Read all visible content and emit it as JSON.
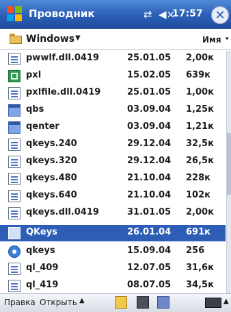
{
  "titlebar": {
    "title": "Проводник",
    "conn_icon": "⇄",
    "volume_icon": "◀×",
    "time": "17:57",
    "close_glyph": "✕"
  },
  "folderbar": {
    "folder_name": "Windows",
    "chevron": "▼",
    "sort_label": "Имя",
    "sort_chevron": "▾"
  },
  "files": [
    {
      "name": "pwwlf.dll.0419",
      "date": "25.01.05",
      "size": "2,00к",
      "icon": "document-icon",
      "selected": false
    },
    {
      "name": "pxl",
      "date": "15.02.05",
      "size": "639к",
      "icon": "spreadsheet-icon",
      "selected": false
    },
    {
      "name": "pxlfile.dll.0419",
      "date": "25.01.05",
      "size": "1,00к",
      "icon": "document-icon",
      "selected": false
    },
    {
      "name": "qbs",
      "date": "03.09.04",
      "size": "1,25к",
      "icon": "application-icon",
      "selected": false
    },
    {
      "name": "qenter",
      "date": "03.09.04",
      "size": "1,21к",
      "icon": "application-icon",
      "selected": false
    },
    {
      "name": "qkeys.240",
      "date": "29.12.04",
      "size": "32,5к",
      "icon": "document-icon",
      "selected": false
    },
    {
      "name": "qkeys.320",
      "date": "29.12.04",
      "size": "26,5к",
      "icon": "document-icon",
      "selected": false
    },
    {
      "name": "qkeys.480",
      "date": "21.10.04",
      "size": "228к",
      "icon": "document-icon",
      "selected": false
    },
    {
      "name": "qkeys.640",
      "date": "21.10.04",
      "size": "102к",
      "icon": "document-icon",
      "selected": false
    },
    {
      "name": "qkeys.dll.0419",
      "date": "31.01.05",
      "size": "2,00к",
      "icon": "document-icon",
      "selected": false
    },
    {
      "name": "QKeys",
      "date": "26.01.04",
      "size": "691к",
      "icon": "application-icon",
      "selected": true
    },
    {
      "name": "qkeys",
      "date": "15.09.04",
      "size": "256",
      "icon": "help-icon",
      "selected": false
    },
    {
      "name": "ql_409",
      "date": "12.07.05",
      "size": "31,6к",
      "icon": "document-icon",
      "selected": false
    },
    {
      "name": "ql_419",
      "date": "08.07.05",
      "size": "34,5к",
      "icon": "document-icon",
      "selected": false
    }
  ],
  "menubar": {
    "edit_label": "Правка",
    "open_label": "Открыть",
    "arrow": "▲",
    "kbd_arrow": "▲"
  },
  "colors": {
    "titlebar": "#2a5eb6",
    "selection": "#2d5db4"
  }
}
